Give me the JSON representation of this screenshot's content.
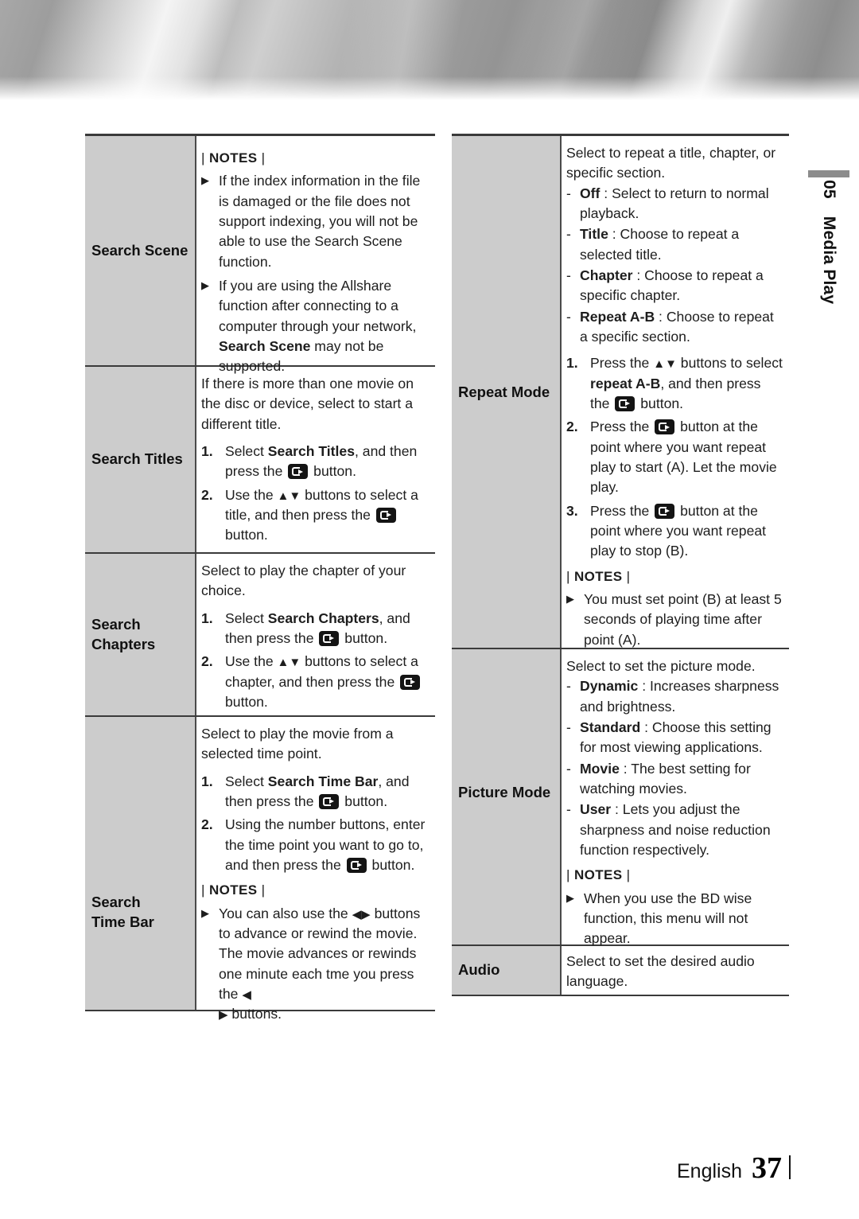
{
  "banner": {
    "name": "brushed-metal-header"
  },
  "side_tab": {
    "number": "05",
    "label": "Media Play"
  },
  "icons": {
    "enter_button": "enter-button-icon",
    "bullet": "▶",
    "updown": "▲▼",
    "leftright": "◀▶"
  },
  "notes_label": {
    "open": "|",
    "text": "NOTES",
    "close": "|"
  },
  "left_table": {
    "rows": [
      {
        "label": "Search Scene",
        "notes_head": "NOTES",
        "bullets": [
          "If the index information in the file is damaged or the file does not support indexing, you will not be able to use the Search Scene function.",
          {
            "pre": "If you are using the Allshare function after connecting to a computer through your network, ",
            "bold": "Search Scene",
            "post": " may not be supported."
          }
        ]
      },
      {
        "label": "Search Titles",
        "intro": "If there is more than one movie on the disc or device, select to start a different title.",
        "steps": [
          {
            "num": "1.",
            "pre": "Select ",
            "bold": "Search Titles",
            "mid": ", and then press the ",
            "icon": "enter",
            "post": " button."
          },
          {
            "num": "2.",
            "pre": "Use the ",
            "arrows": "▲▼",
            "mid": " buttons to select a title, and then press the ",
            "icon": "enter",
            "post": " button."
          }
        ]
      },
      {
        "label": "Search Chapters",
        "intro": "Select to play the chapter of your choice.",
        "steps": [
          {
            "num": "1.",
            "pre": "Select ",
            "bold": "Search Chapters",
            "mid": ", and then press the ",
            "icon": "enter",
            "post": " button."
          },
          {
            "num": "2.",
            "pre": "Use the ",
            "arrows": "▲▼",
            "mid": " buttons to select a chapter, and then press the ",
            "icon": "enter",
            "post": " button."
          }
        ]
      },
      {
        "label": "Search Time Bar",
        "intro": "Select to play the movie from a selected time point.",
        "steps": [
          {
            "num": "1.",
            "pre": "Select ",
            "bold": "Search Time Bar",
            "mid": ", and then press the ",
            "icon": "enter",
            "post": " button."
          },
          {
            "num": "2.",
            "pre": "Using the number buttons, enter the time point you want to go to, and then press the ",
            "icon": "enter",
            "post": " button."
          }
        ],
        "notes_head": "NOTES",
        "note_text_a": "You can also use the ",
        "note_arrows_a": "◀▶",
        "note_text_b": " buttons to advance or rewind the movie. The movie advances or rewinds one minute each tme you press the ",
        "note_arrows_b": "◀",
        "note_arrows_c": "▶",
        "note_text_c": " buttons."
      }
    ]
  },
  "right_table": {
    "rows": [
      {
        "label": "Repeat Mode",
        "intro": "Select to repeat a title, chapter, or specific section.",
        "options": [
          {
            "bold": "Off",
            "text": " : Select to return to normal playback."
          },
          {
            "bold": "Title",
            "text": " : Choose to repeat a selected title."
          },
          {
            "bold": "Chapter",
            "text": " : Choose to repeat a specific chapter."
          },
          {
            "bold": "Repeat A-B",
            "text": " : Choose to repeat a specific section."
          }
        ],
        "steps": [
          {
            "num": "1.",
            "pre": "Press the ",
            "arrows": "▲▼",
            "mid": " buttons to select ",
            "bold": "repeat A-B",
            "mid2": ", and then press the ",
            "icon": "enter",
            "post": " button."
          },
          {
            "num": "2.",
            "pre": "Press the ",
            "icon": "enter",
            "post": " button at the point where you want repeat play to start (A). Let the movie play."
          },
          {
            "num": "3.",
            "pre": "Press the ",
            "icon": "enter",
            "post": " button at the point where you want repeat play to stop (B)."
          }
        ],
        "notes_head": "NOTES",
        "note": "You must set point (B) at least 5 seconds of playing time after point (A)."
      },
      {
        "label": "Picture Mode",
        "intro": "Select to set the picture mode.",
        "options": [
          {
            "bold": "Dynamic",
            "text": " : Increases sharpness and brightness."
          },
          {
            "bold": "Standard",
            "text": " : Choose this setting for most viewing applications."
          },
          {
            "bold": "Movie",
            "text": " : The best setting for watching movies."
          },
          {
            "bold": "User",
            "text": " : Lets you adjust the sharpness and noise reduction function respectively."
          }
        ],
        "notes_head": "NOTES",
        "note": "When you use the BD wise function, this menu will not appear."
      },
      {
        "label": "Audio",
        "intro": "Select to set the desired audio language."
      }
    ]
  },
  "footer": {
    "language": "English",
    "page": "37"
  }
}
